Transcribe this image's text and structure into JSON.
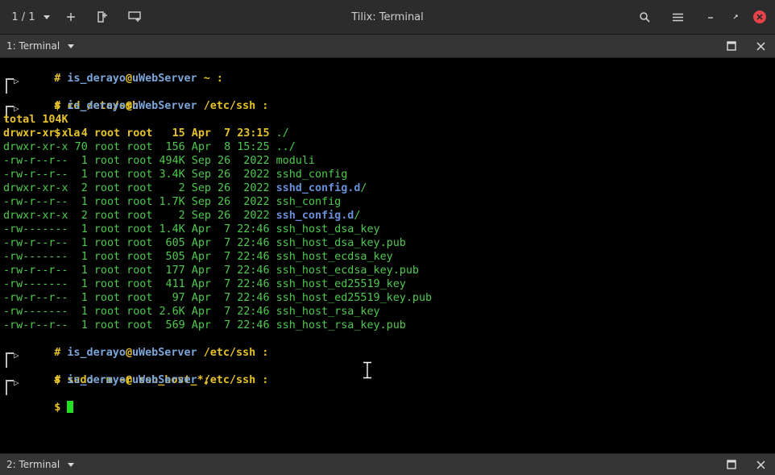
{
  "titlebar": {
    "session_count": "1 / 1",
    "title": "Tilix: Terminal"
  },
  "pane_top": {
    "title": "1: Terminal"
  },
  "pane_bottom": {
    "title": "2: Terminal"
  },
  "prompts": [
    {
      "user": "is_derayo",
      "at": "@",
      "host": "uWebServer",
      "dir": "~ :",
      "cmd": "cd /etc/ssh"
    },
    {
      "user": "is_derayo",
      "at": "@",
      "host": "uWebServer",
      "dir": "/etc/ssh :",
      "cmd": "la"
    },
    {
      "user": "is_derayo",
      "at": "@",
      "host": "uWebServer",
      "dir": "/etc/ssh :",
      "cmd": "sudo rm -r ssh_host_*;"
    },
    {
      "user": "is_derayo",
      "at": "@",
      "host": "uWebServer",
      "dir": "/etc/ssh :",
      "cmd": ""
    }
  ],
  "listing": {
    "total": "total 104K",
    "rows": [
      {
        "meta": "drwxr-xr-x  4 root root   15 Apr  7 23:15 ",
        "name": "./"
      },
      {
        "meta": "drwxr-xr-x 70 root root  156 Apr  8 15:25 ",
        "name": "../"
      },
      {
        "meta": "-rw-r--r--  1 root root 494K Sep 26  2022 ",
        "name": "moduli"
      },
      {
        "meta": "-rw-r--r--  1 root root 3.4K Sep 26  2022 ",
        "name": "sshd_config"
      },
      {
        "meta": "drwxr-xr-x  2 root root    2 Sep 26  2022 ",
        "name": "sshd_config.d",
        "suffix": "/"
      },
      {
        "meta": "-rw-r--r--  1 root root 1.7K Sep 26  2022 ",
        "name": "ssh_config"
      },
      {
        "meta": "drwxr-xr-x  2 root root    2 Sep 26  2022 ",
        "name": "ssh_config.d",
        "suffix": "/"
      },
      {
        "meta": "-rw-------  1 root root 1.4K Apr  7 22:46 ",
        "name": "ssh_host_dsa_key"
      },
      {
        "meta": "-rw-r--r--  1 root root  605 Apr  7 22:46 ",
        "name": "ssh_host_dsa_key.pub"
      },
      {
        "meta": "-rw-------  1 root root  505 Apr  7 22:46 ",
        "name": "ssh_host_ecdsa_key"
      },
      {
        "meta": "-rw-r--r--  1 root root  177 Apr  7 22:46 ",
        "name": "ssh_host_ecdsa_key.pub"
      },
      {
        "meta": "-rw-------  1 root root  411 Apr  7 22:46 ",
        "name": "ssh_host_ed25519_key"
      },
      {
        "meta": "-rw-r--r--  1 root root   97 Apr  7 22:46 ",
        "name": "ssh_host_ed25519_key.pub"
      },
      {
        "meta": "-rw-------  1 root root 2.6K Apr  7 22:46 ",
        "name": "ssh_host_rsa_key"
      },
      {
        "meta": "-rw-r--r--  1 root root  569 Apr  7 22:46 ",
        "name": "ssh_host_rsa_key.pub"
      }
    ]
  },
  "icons": {
    "dropdown": "chevron-down-icon",
    "add": "plus-icon",
    "new_session": "new-session-icon",
    "sync_input": "sync-input-icon",
    "search": "search-icon",
    "menu": "hamburger-menu-icon",
    "minimize": "minimize-icon",
    "maximize": "maximize-icon",
    "close": "close-icon",
    "pane_maximize": "pane-maximize-icon",
    "pane_close": "pane-close-icon"
  },
  "colors": {
    "prompt_yellow": "#e6c229",
    "user_blue": "#7aa6da",
    "listing_green": "#4ec94e",
    "dir_blue": "#6a8fd8",
    "cursor_green": "#22e022",
    "close_red": "#e8424b"
  }
}
